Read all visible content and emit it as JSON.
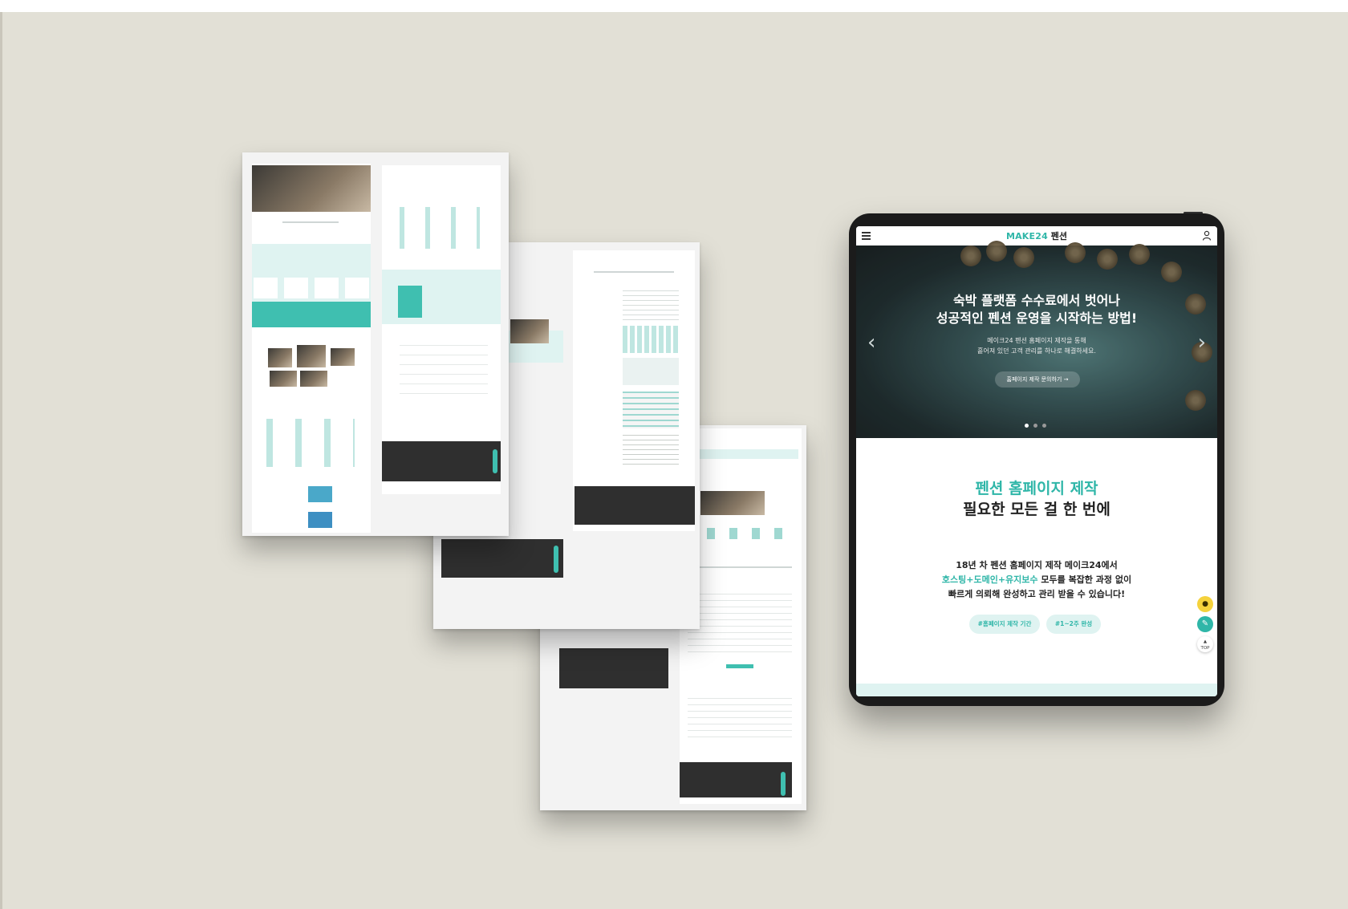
{
  "tablet": {
    "header": {
      "logo_brand": "MAKE24",
      "logo_sub": "펜션"
    },
    "hero": {
      "title_line1": "숙박 플랫폼 수수료에서 벗어나",
      "title_line2": "성공적인 펜션 운영을 시작하는 방법!",
      "desc_line1": "메이크24 펜션 홈페이지 제작을 통해",
      "desc_line2": "흩어져 있던 고객 관리를 하나로 해결하세요.",
      "cta_label": "홈페이지 제작 문의하기  →",
      "slides_total": 3,
      "slide_active": 1
    },
    "section": {
      "title_line1": "펜션 홈페이지 제작",
      "title_line2": "필요한 모든 걸 한 번에",
      "body_line1": "18년 차 펜션 홈페이지 제작 메이크24에서",
      "body_line2_highlight": "호스팅+도메인+유지보수",
      "body_line2_rest": " 모두를 복잡한 과정 없이",
      "body_line3": "빠르게 의뢰해 완성하고 관리 받을 수 있습니다!",
      "tags": [
        "#홈페이지 제작 기간",
        "#1~2주 완성"
      ]
    },
    "floating": {
      "top_label": "TOP"
    }
  },
  "colors": {
    "brand_teal": "#2fb6a8",
    "mint_bg": "#dff3f1",
    "backdrop": "#e2e0d6",
    "kakao_yellow": "#f5d23c"
  },
  "icons": [
    "hamburger-menu-icon",
    "user-icon",
    "chevron-left-icon",
    "chevron-right-icon",
    "kakao-chat-icon",
    "pencil-icon",
    "arrow-up-icon"
  ]
}
